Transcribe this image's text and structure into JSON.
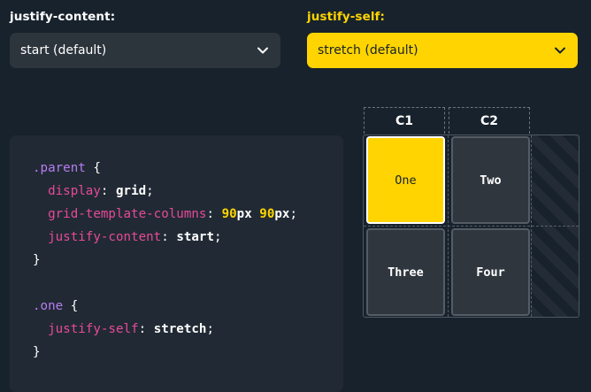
{
  "controls": {
    "justify_content": {
      "label": "justify-content:",
      "selected": "start (default)",
      "color": "#ffffff"
    },
    "justify_self": {
      "label": "justify-self:",
      "selected": "stretch (default)",
      "label_color": "#ffd400",
      "background": "#ffd400"
    }
  },
  "code": {
    "selector_parent": ".parent",
    "open_brace": " {",
    "close_brace": "}",
    "prop_display": "display",
    "val_display": "grid",
    "prop_columns": "grid-template-columns",
    "num1": "90",
    "unit1": "px",
    "num2": "90",
    "unit2": "px",
    "prop_justify_content": "justify-content",
    "val_justify_content": "start",
    "selector_one": ".one",
    "prop_justify_self": "justify-self",
    "val_justify_self": "stretch",
    "colon": ": ",
    "semicolon": ";",
    "space": " "
  },
  "demo": {
    "columns": [
      "C1",
      "C2"
    ],
    "cells": [
      "One",
      "Two",
      "Three",
      "Four"
    ],
    "highlight_color": "#ffd400"
  },
  "icons": {
    "dropdown": "chevron-down-icon"
  }
}
